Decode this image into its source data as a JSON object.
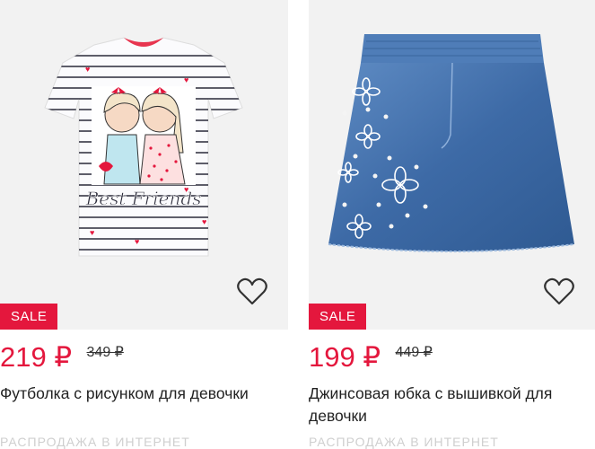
{
  "products": [
    {
      "image_alt": "tshirt-image",
      "sale_label": "SALE",
      "price": "219 ₽",
      "old_price": "349 ₽",
      "title": "Футболка с рисунком для девочки",
      "shirt_text": "Best Friends",
      "below_text": "РАСПРОДАЖА В ИНТЕРНЕТ"
    },
    {
      "image_alt": "skirt-image",
      "sale_label": "SALE",
      "price": "199 ₽",
      "old_price": "449 ₽",
      "title": "Джинсовая юбка с вышивкой для девочки",
      "below_text": "РАСПРОДАЖА В ИНТЕРНЕТ"
    }
  ],
  "colors": {
    "sale_red": "#e4173d",
    "image_bg": "#f2f2f2",
    "denim": "#3d6aa6"
  },
  "icons": {
    "favorite": "heart-outline-icon"
  }
}
